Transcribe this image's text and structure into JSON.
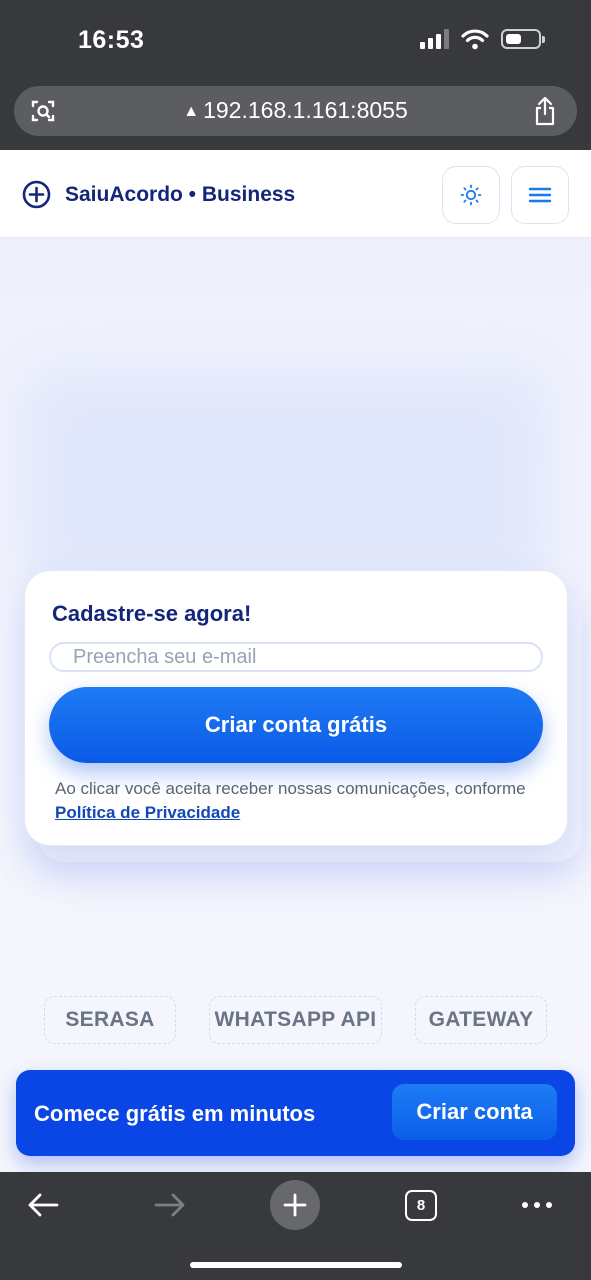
{
  "status_bar": {
    "time": "16:53",
    "icons": [
      "signal-icon",
      "wifi-icon",
      "battery-icon"
    ]
  },
  "browser": {
    "url": "192.168.1.161:8055",
    "url_warning_icon": "warning-icon",
    "tab_count": "8",
    "toolbar_icons": [
      "back-arrow-icon",
      "forward-arrow-icon",
      "new-tab-icon",
      "tabs-icon",
      "more-icon"
    ]
  },
  "header": {
    "brand": "SaiuAcordo • Business",
    "brand_icon": "plus-circle-icon",
    "theme_icon": "sun-icon",
    "menu_icon": "hamburger-icon"
  },
  "signup": {
    "title": "Cadastre-se agora!",
    "email_placeholder": "Preencha seu e-mail",
    "email_value": "",
    "button_label": "Criar conta grátis",
    "consent_text": "Ao clicar você aceita receber nossas comunicações, conforme ",
    "privacy_link": "Política de Privacidade"
  },
  "integrations": [
    "SERASA",
    "WHATSAPP API",
    "GATEWAY"
  ],
  "promo": {
    "text": "Comece grátis em minutos",
    "button_label": "Criar conta"
  },
  "colors": {
    "brand_navy": "#14267a",
    "primary_blue": "#0a5ae6",
    "promo_blue": "#0a45e6",
    "browser_chrome": "#37393c"
  }
}
